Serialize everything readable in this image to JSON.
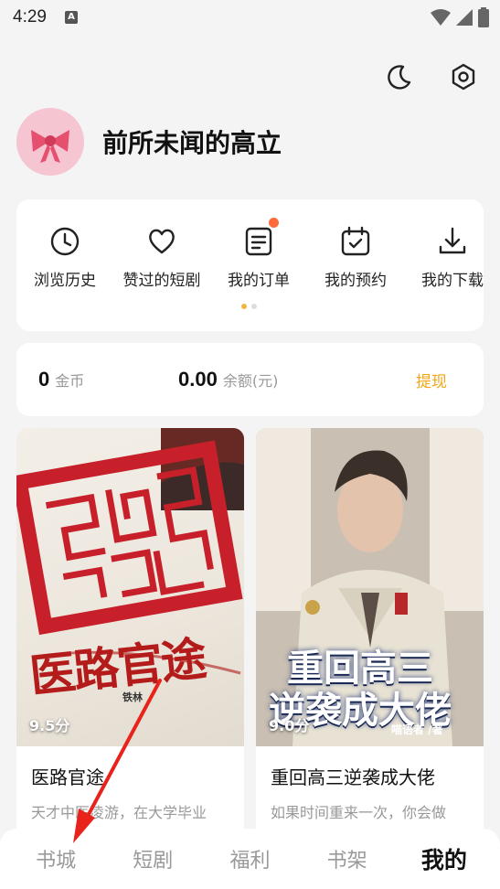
{
  "status": {
    "time": "4:29",
    "notif_letter": "A"
  },
  "profile": {
    "username": "前所未闻的高立"
  },
  "quick_actions": [
    {
      "label": "浏览历史",
      "icon": "clock-icon"
    },
    {
      "label": "赞过的短剧",
      "icon": "heart-icon"
    },
    {
      "label": "我的订单",
      "icon": "order-icon",
      "badge": true
    },
    {
      "label": "我的预约",
      "icon": "calendar-check-icon"
    },
    {
      "label": "我的下载",
      "icon": "download-icon"
    }
  ],
  "wallet": {
    "coins_value": "0",
    "coins_unit": "金币",
    "balance_value": "0.00",
    "balance_unit": "余额(元)",
    "withdraw_label": "提现"
  },
  "books": [
    {
      "title": "医路官途",
      "score": "9.5分",
      "desc": "天才中医凌游，在大学毕业",
      "cover_text": "医路官途",
      "cover_author": "铁林"
    },
    {
      "title": "重回高三逆袭成大佬",
      "score": "9.0分",
      "desc": "如果时间重来一次，你会做",
      "cover_text_line1": "重回高三",
      "cover_text_line2": "逆袭成大佬",
      "cover_author": "喵语者 /著"
    }
  ],
  "tabbar": {
    "tabs": [
      "书城",
      "短剧",
      "福利",
      "书架",
      "我的"
    ],
    "active": "我的"
  },
  "colors": {
    "accent": "#f2a618",
    "badge": "#ff6a3a",
    "annotation_arrow": "#e8231c"
  }
}
